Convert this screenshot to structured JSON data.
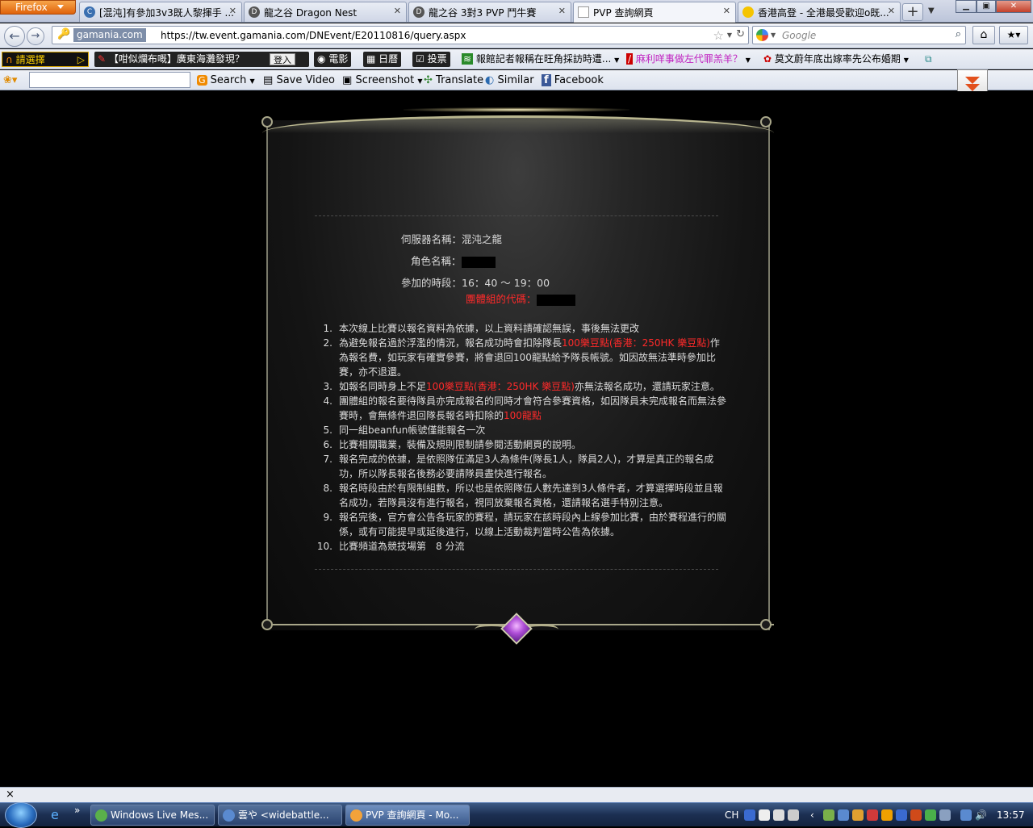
{
  "browser": {
    "app_menu_label": "Firefox",
    "tabs": [
      {
        "icon": "C",
        "title": "[混沌]有參加3v3既人黎揮手 ...",
        "active": false
      },
      {
        "icon": "D",
        "title": "龍之谷 Dragon Nest",
        "active": false
      },
      {
        "icon": "D",
        "title": "龍之谷 3對3 PVP 鬥牛賽",
        "active": false
      },
      {
        "icon": "",
        "title": "PVP 查詢網頁",
        "active": true
      },
      {
        "icon": "",
        "title": "香港高登 - 全港最受歡迎o既...",
        "active": false
      }
    ],
    "new_tab_label": "+",
    "identity_badge": "gamania.com",
    "url": "https://tw.event.gamania.com/DNEvent/E20110816/query.aspx",
    "search_placeholder": "Google"
  },
  "bookmarks_bar": {
    "items": [
      "請選擇",
      "【咁似爛布嘅】廣東海灘發現？",
      "登入",
      "電影",
      "日曆",
      "投票",
      "報館記者報稱在旺角採訪時遭...",
      "麻利咩事做左代罪羔羊？",
      "莫文蔚年底出嫁率先公布婚期"
    ]
  },
  "toolbar": {
    "search_label": "Search",
    "save_video_label": "Save Video",
    "screenshot_label": "Screenshot",
    "translate_label": "Translate",
    "similar_label": "Similar",
    "facebook_label": "Facebook"
  },
  "page": {
    "server_label": "伺服器名稱：",
    "server_value": "混沌之龍",
    "character_label": "角色名稱：",
    "character_value": "",
    "time_label": "參加的時段：",
    "time_value": "16：40 ～ 19：00",
    "team_code_label": "團體組的代碼：",
    "team_code_value": "",
    "rules": [
      {
        "num": "1.",
        "parts": [
          {
            "t": "本次線上比賽以報名資料為依據，以上資料請確認無誤，事後無法更改"
          }
        ]
      },
      {
        "num": "2.",
        "parts": [
          {
            "t": "為避免報名過於浮濫的情況，報名成功時會扣除隊長"
          },
          {
            "t": "100樂豆點(香港：250HK 樂豆點)",
            "red": true
          },
          {
            "t": "作為報名費，如玩家有確實參賽，將會退回100龍點給予隊長帳號。如因故無法準時參加比賽，亦不退還。"
          }
        ]
      },
      {
        "num": "3.",
        "parts": [
          {
            "t": "如報名同時身上不足"
          },
          {
            "t": "100樂豆點(香港：250HK 樂豆點)",
            "red": true
          },
          {
            "t": "亦無法報名成功，還請玩家注意。"
          }
        ]
      },
      {
        "num": "4.",
        "parts": [
          {
            "t": "團體組的報名要待隊員亦完成報名的同時才會符合參賽資格，如因隊員未完成報名而無法參賽時，會無條件退回隊長報名時扣除的"
          },
          {
            "t": "100龍點",
            "red": true
          }
        ]
      },
      {
        "num": "5.",
        "parts": [
          {
            "t": "同一組beanfun帳號僅能報名一次"
          }
        ]
      },
      {
        "num": "6.",
        "parts": [
          {
            "t": "比賽相關職業，裝備及規則限制請參閱活動網頁的說明。"
          }
        ]
      },
      {
        "num": "7.",
        "parts": [
          {
            "t": "報名完成的依據，是依照隊伍滿足3人為條件(隊長1人，隊員2人)，才算是真正的報名成功，所以隊長報名後務必要請隊員盡快進行報名。"
          }
        ]
      },
      {
        "num": "8.",
        "parts": [
          {
            "t": "報名時段由於有限制組數，所以也是依照隊伍人數先達到3人條件者，才算選擇時段並且報名成功，若隊員沒有進行報名，視同放棄報名資格，還請報名選手特別注意。"
          }
        ]
      },
      {
        "num": "9.",
        "parts": [
          {
            "t": "報名完後，官方會公告各玩家的賽程，請玩家在該時段內上線參加比賽，由於賽程進行的關係，或有可能提早或延後進行，以線上活動裁判當時公告為依據。"
          }
        ]
      },
      {
        "num": "10.",
        "parts": [
          {
            "t": "比賽頻道為競技場第　8 分流"
          }
        ]
      }
    ]
  },
  "findbar": {
    "close_label": "×"
  },
  "taskbar": {
    "tasks": [
      {
        "title": "Windows Live Mes...",
        "active": false
      },
      {
        "title": "雲や <widebattle...",
        "active": false
      },
      {
        "title": "PVP 查詢網頁 - Mo...",
        "active": true
      }
    ],
    "overflow_label": "»",
    "lang": "CH",
    "clock": "13:57"
  },
  "colors": {
    "accent_red": "#ff2a2a",
    "frame_gold": "#b9b68f"
  }
}
